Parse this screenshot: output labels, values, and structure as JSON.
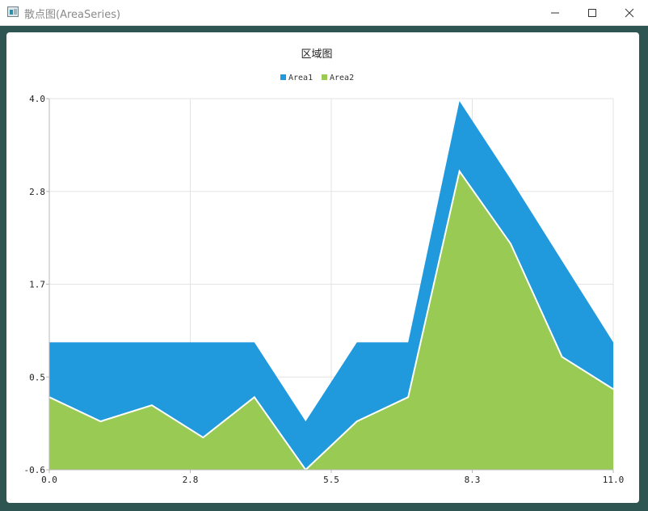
{
  "window": {
    "title": "散点图(AreaSeries)"
  },
  "colors": {
    "area1": "#2199dd",
    "area2": "#99ca53",
    "grid": "#e3e3e3",
    "axis": "#b8b8b8"
  },
  "chart_data": {
    "type": "area",
    "title": "区域图",
    "legend_position": "top-center",
    "grid": true,
    "x": [
      0,
      1,
      2,
      3,
      4,
      5,
      6,
      7,
      8,
      9,
      10,
      11
    ],
    "xlim": [
      0,
      11
    ],
    "ylim": [
      -0.6,
      4.0
    ],
    "xticks": [
      "0.0",
      "2.8",
      "5.5",
      "8.3",
      "11.0"
    ],
    "yticks": [
      "4.0",
      "2.8",
      "1.7",
      "0.5",
      "-0.6"
    ],
    "series": [
      {
        "name": "Area1",
        "values": [
          0.98,
          0.98,
          0.98,
          0.98,
          0.98,
          0.0,
          0.98,
          0.98,
          3.97,
          3.0,
          1.99,
          0.98
        ]
      },
      {
        "name": "Area2",
        "values": [
          0.3,
          0.0,
          0.2,
          -0.2,
          0.3,
          -0.6,
          0.0,
          0.3,
          3.1,
          2.2,
          0.8,
          0.4
        ]
      }
    ]
  }
}
